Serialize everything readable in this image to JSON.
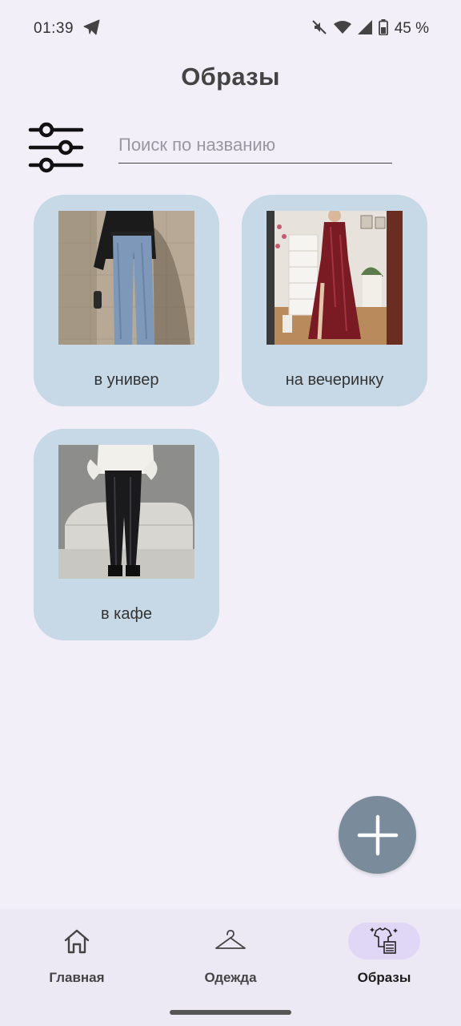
{
  "status_bar": {
    "time": "01:39",
    "battery": "45 %",
    "icons": [
      "telegram-icon",
      "mute-icon",
      "wifi-icon",
      "signal-icon",
      "battery-icon"
    ]
  },
  "header": {
    "title": "Образы"
  },
  "search": {
    "placeholder": "Поиск по названию",
    "value": ""
  },
  "filter": {
    "icon": "sliders-icon"
  },
  "outfits": [
    {
      "label": "в универ"
    },
    {
      "label": "на вечеринку"
    },
    {
      "label": "в кафе"
    }
  ],
  "fab": {
    "icon": "plus-icon"
  },
  "bottom_nav": {
    "items": [
      {
        "label": "Главная",
        "icon": "home-icon",
        "active": false
      },
      {
        "label": "Одежда",
        "icon": "hanger-icon",
        "active": false
      },
      {
        "label": "Образы",
        "icon": "outfit-icon",
        "active": true
      }
    ]
  },
  "colors": {
    "background": "#f2eff9",
    "card": "#c7d8e6",
    "fab": "#7a8c9b",
    "nav_active": "#e0d6f5"
  }
}
